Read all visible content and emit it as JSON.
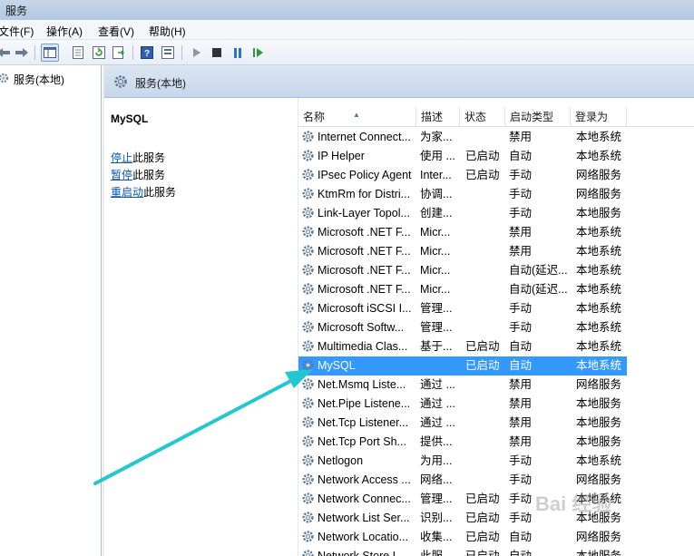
{
  "window": {
    "title": "服务"
  },
  "menu": [
    {
      "label": "文件(F)"
    },
    {
      "label": "操作(A)"
    },
    {
      "label": "查看(V)"
    },
    {
      "label": "帮助(H)"
    }
  ],
  "toolbar": {
    "buttons": [
      "back-icon",
      "forward-icon",
      "show-hide-tree-icon",
      "properties-icon",
      "refresh-icon",
      "export-list-icon",
      "help-icon",
      "detail-view-icon",
      "start-service-icon",
      "stop-service-icon",
      "pause-service-icon",
      "restart-service-icon"
    ]
  },
  "tree": {
    "root_label": "服务(本地)"
  },
  "panel": {
    "header_title": "服务(本地)"
  },
  "extended": {
    "service_name": "MySQL",
    "actions": [
      {
        "link": "停止",
        "suffix": "此服务"
      },
      {
        "link": "暂停",
        "suffix": "此服务"
      },
      {
        "link": "重启动",
        "suffix": "此服务"
      }
    ]
  },
  "list": {
    "columns": [
      "名称",
      "描述",
      "状态",
      "启动类型",
      "登录为"
    ],
    "rows": [
      {
        "name": "Internet Connect...",
        "desc": "为家...",
        "status": "",
        "start": "禁用",
        "logon": "本地系统"
      },
      {
        "name": "IP Helper",
        "desc": "使用 ...",
        "status": "已启动",
        "start": "自动",
        "logon": "本地系统"
      },
      {
        "name": "IPsec Policy Agent",
        "desc": "Inter...",
        "status": "已启动",
        "start": "手动",
        "logon": "网络服务"
      },
      {
        "name": "KtmRm for Distri...",
        "desc": "协调...",
        "status": "",
        "start": "手动",
        "logon": "网络服务"
      },
      {
        "name": "Link-Layer Topol...",
        "desc": "创建...",
        "status": "",
        "start": "手动",
        "logon": "本地服务"
      },
      {
        "name": "Microsoft .NET F...",
        "desc": "Micr...",
        "status": "",
        "start": "禁用",
        "logon": "本地系统"
      },
      {
        "name": "Microsoft .NET F...",
        "desc": "Micr...",
        "status": "",
        "start": "禁用",
        "logon": "本地系统"
      },
      {
        "name": "Microsoft .NET F...",
        "desc": "Micr...",
        "status": "",
        "start": "自动(延迟...",
        "logon": "本地系统"
      },
      {
        "name": "Microsoft .NET F...",
        "desc": "Micr...",
        "status": "",
        "start": "自动(延迟...",
        "logon": "本地系统"
      },
      {
        "name": "Microsoft iSCSI I...",
        "desc": "管理...",
        "status": "",
        "start": "手动",
        "logon": "本地系统"
      },
      {
        "name": "Microsoft Softw...",
        "desc": "管理...",
        "status": "",
        "start": "手动",
        "logon": "本地系统"
      },
      {
        "name": "Multimedia Clas...",
        "desc": "基于...",
        "status": "已启动",
        "start": "自动",
        "logon": "本地系统"
      },
      {
        "name": "MySQL",
        "desc": "",
        "status": "已启动",
        "start": "自动",
        "logon": "本地系统",
        "selected": true
      },
      {
        "name": "Net.Msmq Liste...",
        "desc": "通过 ...",
        "status": "",
        "start": "禁用",
        "logon": "网络服务"
      },
      {
        "name": "Net.Pipe Listene...",
        "desc": "通过 ...",
        "status": "",
        "start": "禁用",
        "logon": "本地服务"
      },
      {
        "name": "Net.Tcp Listener...",
        "desc": "通过 ...",
        "status": "",
        "start": "禁用",
        "logon": "本地服务"
      },
      {
        "name": "Net.Tcp Port Sh...",
        "desc": "提供...",
        "status": "",
        "start": "禁用",
        "logon": "本地服务"
      },
      {
        "name": "Netlogon",
        "desc": "为用...",
        "status": "",
        "start": "手动",
        "logon": "本地系统"
      },
      {
        "name": "Network Access ...",
        "desc": "网络...",
        "status": "",
        "start": "手动",
        "logon": "网络服务"
      },
      {
        "name": "Network Connec...",
        "desc": "管理...",
        "status": "已启动",
        "start": "手动",
        "logon": "本地系统"
      },
      {
        "name": "Network List Ser...",
        "desc": "识别...",
        "status": "已启动",
        "start": "手动",
        "logon": "本地服务"
      },
      {
        "name": "Network Locatio...",
        "desc": "收集...",
        "status": "已启动",
        "start": "自动",
        "logon": "网络服务"
      },
      {
        "name": "Network Store I...",
        "desc": "此服...",
        "status": "已启动",
        "start": "自动",
        "logon": "本地服务"
      }
    ]
  },
  "colors": {
    "selection": "#3399ff",
    "link": "#0b55b6",
    "annotation_arrow": "#22c7cf"
  },
  "watermark": {
    "text": "Bai 经验"
  }
}
